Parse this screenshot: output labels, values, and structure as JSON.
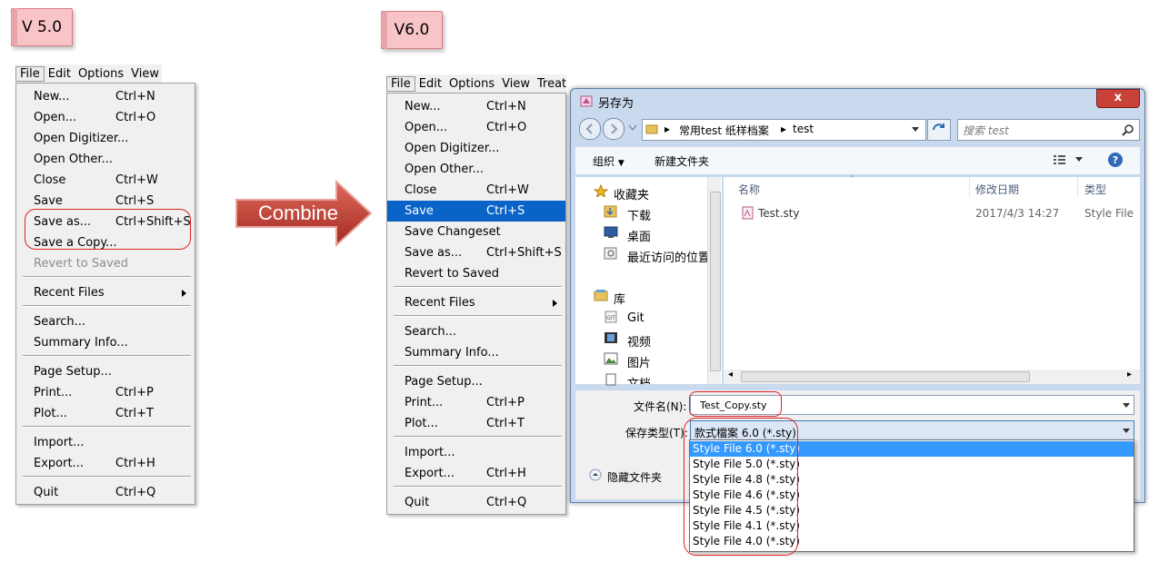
{
  "tags": {
    "v5": "V 5.0",
    "v6": "V6.0"
  },
  "combine_label": "Combine",
  "v5": {
    "menubar": [
      "File",
      "Edit",
      "Options",
      "View"
    ],
    "items": [
      {
        "label": "New...",
        "shortcut": "Ctrl+N"
      },
      {
        "label": "Open...",
        "shortcut": "Ctrl+O"
      },
      {
        "label": "Open Digitizer...",
        "shortcut": ""
      },
      {
        "label": "Open Other...",
        "shortcut": ""
      },
      {
        "label": "Close",
        "shortcut": "Ctrl+W"
      },
      {
        "label": "Save",
        "shortcut": "Ctrl+S"
      },
      {
        "label": "Save as...",
        "shortcut": "Ctrl+Shift+S"
      },
      {
        "label": "Save a Copy...",
        "shortcut": ""
      },
      {
        "label": "Revert to Saved",
        "shortcut": ""
      },
      {
        "label": "Recent Files",
        "shortcut": ""
      },
      {
        "label": "Search...",
        "shortcut": ""
      },
      {
        "label": "Summary Info...",
        "shortcut": ""
      },
      {
        "label": "Page Setup...",
        "shortcut": ""
      },
      {
        "label": "Print...",
        "shortcut": "Ctrl+P"
      },
      {
        "label": "Plot...",
        "shortcut": "Ctrl+T"
      },
      {
        "label": "Import...",
        "shortcut": ""
      },
      {
        "label": "Export...",
        "shortcut": "Ctrl+H"
      },
      {
        "label": "Quit",
        "shortcut": "Ctrl+Q"
      }
    ]
  },
  "v6": {
    "menubar": [
      "File",
      "Edit",
      "Options",
      "View",
      "Treatr"
    ],
    "items": [
      {
        "label": "New...",
        "shortcut": "Ctrl+N"
      },
      {
        "label": "Open...",
        "shortcut": "Ctrl+O"
      },
      {
        "label": "Open Digitizer...",
        "shortcut": ""
      },
      {
        "label": "Open Other...",
        "shortcut": ""
      },
      {
        "label": "Close",
        "shortcut": "Ctrl+W"
      },
      {
        "label": "Save",
        "shortcut": "Ctrl+S"
      },
      {
        "label": "Save Changeset",
        "shortcut": ""
      },
      {
        "label": "Save as...",
        "shortcut": "Ctrl+Shift+S"
      },
      {
        "label": "Revert to Saved",
        "shortcut": ""
      },
      {
        "label": "Recent Files",
        "shortcut": ""
      },
      {
        "label": "Search...",
        "shortcut": ""
      },
      {
        "label": "Summary Info...",
        "shortcut": ""
      },
      {
        "label": "Page Setup...",
        "shortcut": ""
      },
      {
        "label": "Print...",
        "shortcut": "Ctrl+P"
      },
      {
        "label": "Plot...",
        "shortcut": "Ctrl+T"
      },
      {
        "label": "Import...",
        "shortcut": ""
      },
      {
        "label": "Export...",
        "shortcut": "Ctrl+H"
      },
      {
        "label": "Quit",
        "shortcut": "Ctrl+Q"
      }
    ]
  },
  "dialog": {
    "title": "另存为",
    "close": "x",
    "path": [
      "常用test 纸样档案",
      "test"
    ],
    "search_placeholder": "搜索 test",
    "organize": "组织",
    "new_folder": "新建文件夹",
    "nav": {
      "favorites": "收藏夹",
      "downloads": "下载",
      "desktop": "桌面",
      "recent": "最近访问的位置",
      "libraries": "库",
      "git": "Git",
      "videos": "视频",
      "pictures": "图片",
      "documents": "文档"
    },
    "columns": {
      "name": "名称",
      "date": "修改日期",
      "type": "类型"
    },
    "file": {
      "name": "Test.sty",
      "date": "2017/4/3 14:27",
      "type": "Style File"
    },
    "filename_label": "文件名(N):",
    "filename_value": "Test_Copy.sty",
    "savetype_label": "保存类型(T):",
    "savetype_value": "款式檔案 6.0 (*.sty)",
    "hide_folders": "隐藏文件夹",
    "type_options": [
      "Style File  6.0 (*.sty)",
      "Style File  5.0 (*.sty)",
      "Style File  4.8 (*.sty)",
      "Style File  4.6 (*.sty)",
      "Style File  4.5 (*.sty)",
      "Style File  4.1 (*.sty)",
      "Style File  4.0 (*.sty)"
    ]
  }
}
